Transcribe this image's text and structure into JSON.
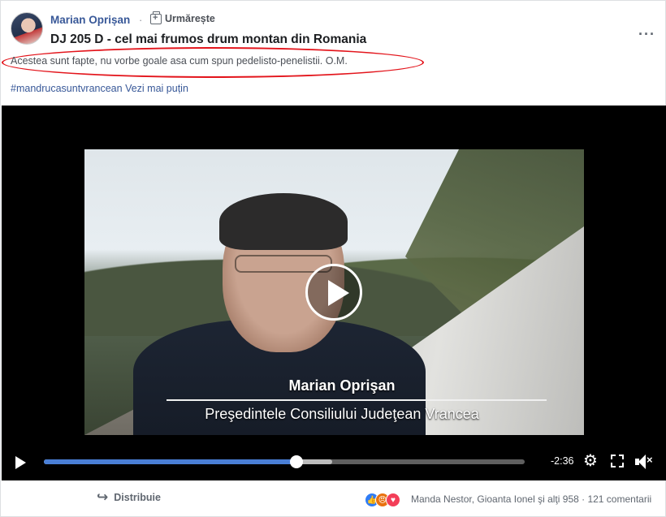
{
  "post": {
    "author": "Marian Oprișan",
    "separator": "·",
    "follow_label": "Urmărește",
    "title": "DJ 205 D - cel mai frumos drum montan din Romania",
    "more_label": "···",
    "description": "Acestea sunt fapte, nu vorbe goale asa cum spun pedelisto-penelistii. O.M.",
    "hashtag": "#mandrucasuntvrancean",
    "see_less": "Vezi mai puțin"
  },
  "video": {
    "caption_name": "Marian Oprişan",
    "caption_role": "Preşedintele Consiliului Judeţean Vrancea",
    "progress_fraction": 0.525,
    "buffer_fraction": 0.6,
    "time_remaining": "-2:36"
  },
  "footer": {
    "share_label": "Distribuie",
    "reactions_text": "Manda Nestor, Gioanta Ionel şi alţi 958 · 121 comentarii"
  },
  "icons": {
    "follow": "follow-icon",
    "share": "share-icon",
    "settings": "gear-icon",
    "fullscreen": "expand-icon",
    "volume": "volume-muted-icon",
    "play": "play-icon"
  },
  "colors": {
    "link": "#385898",
    "highlight": "#e3141b",
    "progress": "#4a7fd6",
    "like": "#2f7cf6",
    "angry": "#e9710f",
    "love": "#f33e58"
  }
}
